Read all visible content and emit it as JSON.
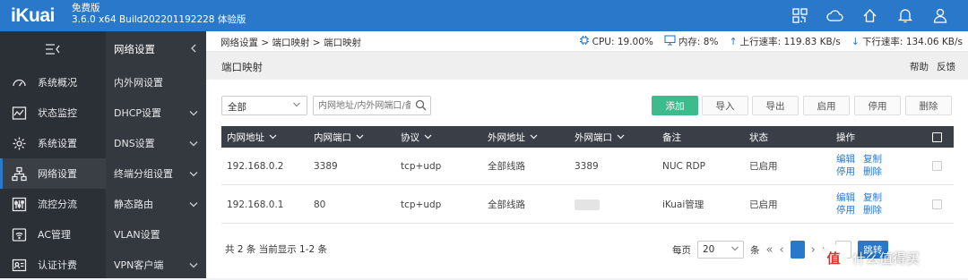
{
  "app": {
    "logo": "iKuai",
    "edition": "免费版",
    "build": "3.6.0 x64 Build202201192228 体验版",
    "accent": "#2a78c9",
    "top_icons": [
      "qr-code-icon",
      "cloud-icon",
      "home-icon",
      "bell-icon",
      "user-icon"
    ]
  },
  "sidebar": {
    "collapse_icon": "menu-collapse-icon",
    "items": [
      {
        "label": "系统概况",
        "icon": "dashboard-icon"
      },
      {
        "label": "状态监控",
        "icon": "monitor-icon"
      },
      {
        "label": "系统设置",
        "icon": "gear-icon"
      },
      {
        "label": "网络设置",
        "icon": "network-icon",
        "active": true
      },
      {
        "label": "流控分流",
        "icon": "sliders-icon"
      },
      {
        "label": "AC管理",
        "icon": "ac-icon"
      },
      {
        "label": "认证计费",
        "icon": "id-card-icon"
      }
    ]
  },
  "subnav": {
    "title": "网络设置",
    "items": [
      {
        "label": "内外网设置"
      },
      {
        "label": "DHCP设置"
      },
      {
        "label": "DNS设置"
      },
      {
        "label": "终端分组设置"
      },
      {
        "label": "静态路由"
      },
      {
        "label": "VLAN设置"
      },
      {
        "label": "VPN客户端"
      }
    ]
  },
  "breadcrumb": "网络设置 > 端口映射 > 端口映射",
  "stats": {
    "cpu": "CPU: 19.00%",
    "mem": "内存: 8%",
    "up": "上行速率: 119.83 KB/s",
    "down": "下行速率: 134.06 KB/s"
  },
  "page": {
    "title": "端口映射",
    "help": "帮助",
    "feedback": "反馈"
  },
  "toolbar": {
    "filter_value": "全部",
    "search_placeholder": "内网地址/内外网端口/备注",
    "add": "添加",
    "import": "导入",
    "export": "导出",
    "enable": "启用",
    "disable": "停用",
    "delete": "删除"
  },
  "table": {
    "headers": [
      "内网地址",
      "内网端口",
      "协议",
      "外网地址",
      "外网端口",
      "备注",
      "状态",
      "操作"
    ],
    "rows": [
      {
        "lan_ip": "192.168.0.2",
        "lan_port": "3389",
        "protocol": "tcp+udp",
        "wan_addr": "全部线路",
        "wan_port": "3389",
        "note": "NUC RDP",
        "status": "已启用",
        "ops": [
          "编辑",
          "复制",
          "停用",
          "删除"
        ]
      },
      {
        "lan_ip": "192.168.0.1",
        "lan_port": "80",
        "protocol": "tcp+udp",
        "wan_addr": "全部线路",
        "wan_port": "",
        "note": "iKuai管理",
        "status": "已启用",
        "ops": [
          "编辑",
          "复制",
          "停用",
          "删除"
        ]
      }
    ]
  },
  "footer": {
    "total": "共 2 条 当前显示 1-2 条",
    "per_page_label": "每页",
    "per_page": "20",
    "unit": "条",
    "go": "跳转"
  },
  "watermark": {
    "badge": "值",
    "text": "什么值得买"
  }
}
